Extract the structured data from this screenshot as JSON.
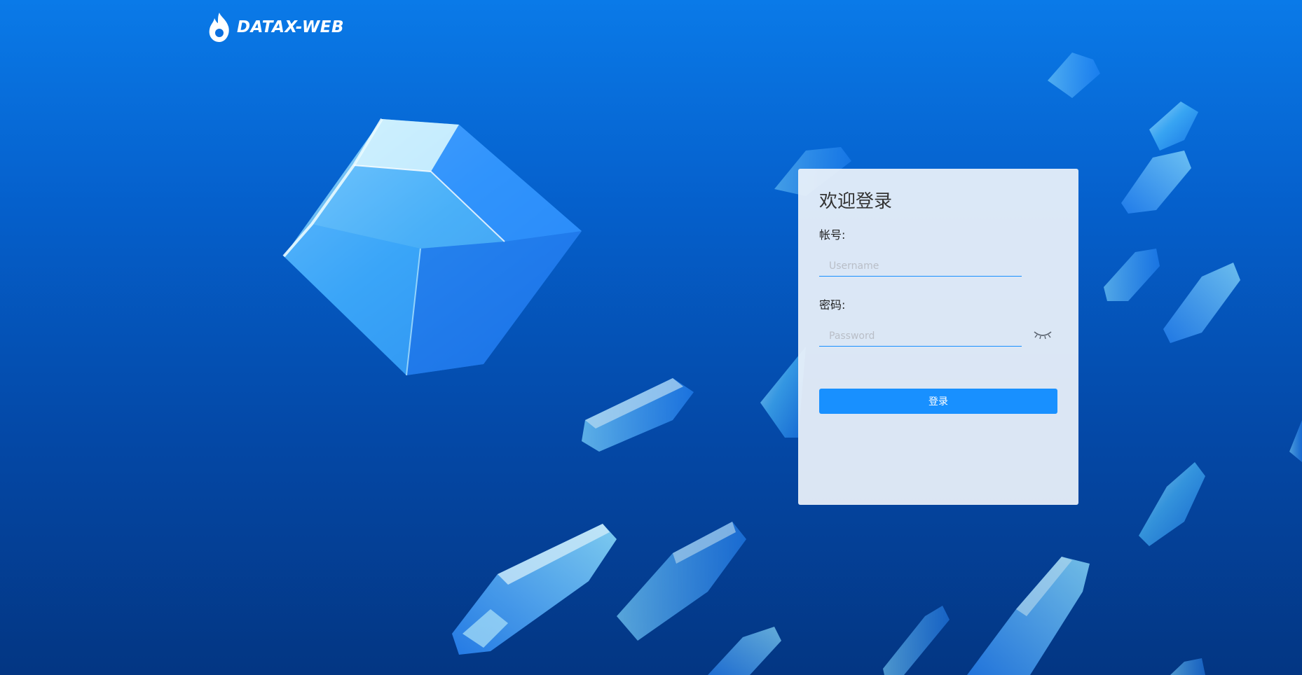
{
  "brand": {
    "logo_icon": "flame-icon",
    "name": "DATAX-WEB"
  },
  "login": {
    "title": "欢迎登录",
    "username_label": "帐号:",
    "username_placeholder": "Username",
    "username_value": "",
    "password_label": "密码:",
    "password_placeholder": "Password",
    "password_value": "",
    "password_toggle_icon": "eye-closed-icon",
    "submit_label": "登录"
  },
  "colors": {
    "background_top": "#0a7ae8",
    "background_bottom": "#033683",
    "accent": "#1890ff",
    "card": "#ecf2fa"
  }
}
